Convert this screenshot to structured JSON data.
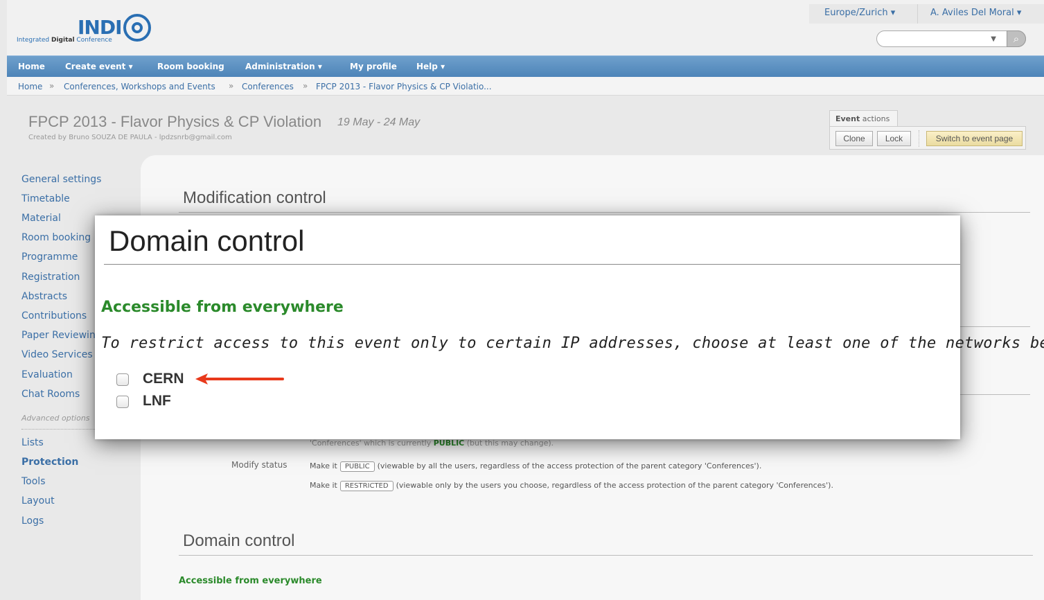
{
  "header": {
    "logo": {
      "word": "INDI",
      "tagline_pre": "Integrated ",
      "tagline_bold": "Digital",
      "tagline_post": " Conference"
    },
    "timezone": "Europe/Zurich ▾",
    "user": "A. Aviles Del Moral ▾",
    "search_placeholder": ""
  },
  "nav": {
    "items": [
      "Home",
      "Create event  ▾",
      "Room booking",
      "Administration  ▾",
      "My profile",
      "Help  ▾"
    ]
  },
  "breadcrumb": {
    "items": [
      "Home",
      "Conferences, Workshops and Events",
      "Conferences",
      "FPCP 2013 - Flavor Physics & CP Violatio..."
    ],
    "separator": "»"
  },
  "event": {
    "title": "FPCP 2013 - Flavor Physics & CP Violation",
    "dates": "19 May - 24 May",
    "created": "Created by Bruno SOUZA DE PAULA - lpdzsnrb@gmail.com"
  },
  "event_actions": {
    "tab_bold": "Event",
    "tab_rest": " actions",
    "clone": "Clone",
    "lock": "Lock",
    "switch": "Switch to event page"
  },
  "menu": {
    "items": [
      "General settings",
      "Timetable",
      "Material",
      "Room booking",
      "Programme",
      "Registration",
      "Abstracts",
      "Contributions",
      "Paper Reviewing",
      "Video Services",
      "Evaluation",
      "Chat Rooms"
    ],
    "advanced_label": "Advanced options",
    "advanced_items": [
      "Lists",
      "Protection",
      "Tools",
      "Layout",
      "Logs"
    ],
    "active": "Protection"
  },
  "main": {
    "modification_title": "Modification control",
    "domain_title": "Domain control",
    "partial_line_pre": "'Conferences' which is currently ",
    "partial_line_bold": "PUBLIC",
    "partial_line_post": " (but this may change).",
    "modify_status_label": "Modify status",
    "make_it": "Make it",
    "public_tag": "PUBLIC",
    "public_desc": "(viewable by all the users, regardless of the access protection of the parent category 'Conferences').",
    "restricted_tag": "RESTRICTED",
    "restricted_desc": "(viewable only by the users you choose, regardless of the access protection of the parent category 'Conferences').",
    "accessible_small": "Accessible from everywhere"
  },
  "dialog": {
    "title": "Domain control",
    "status": "Accessible from everywhere",
    "instructions": "To restrict access to this event only to certain IP addresses, choose at least one of the networks below.",
    "networks": [
      {
        "label": "CERN",
        "checked": false
      },
      {
        "label": "LNF",
        "checked": false
      }
    ],
    "arrow_color": "#e8391b"
  }
}
